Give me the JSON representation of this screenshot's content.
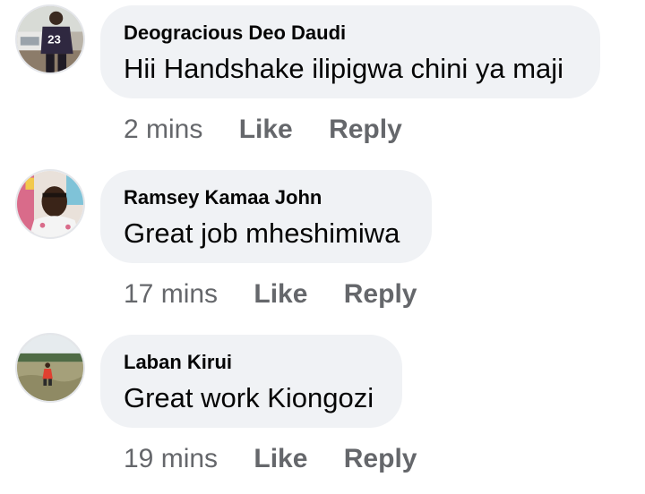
{
  "comments": [
    {
      "author": "Deogracious Deo Daudi",
      "text": "Hii Handshake ilipigwa chini ya maji",
      "time": "2 mins",
      "like_label": "Like",
      "reply_label": "Reply",
      "avatar_icon": "person-jersey-avatar-icon"
    },
    {
      "author": "Ramsey Kamaa John",
      "text": "Great job mheshimiwa",
      "time": "17 mins",
      "like_label": "Like",
      "reply_label": "Reply",
      "avatar_icon": "person-selfie-avatar-icon"
    },
    {
      "author": "Laban Kirui",
      "text": "Great work Kiongozi",
      "time": "19 mins",
      "like_label": "Like",
      "reply_label": "Reply",
      "avatar_icon": "landscape-person-avatar-icon"
    }
  ],
  "colors": {
    "bubble": "#f0f2f5",
    "text": "#050505",
    "meta": "#65676b"
  }
}
